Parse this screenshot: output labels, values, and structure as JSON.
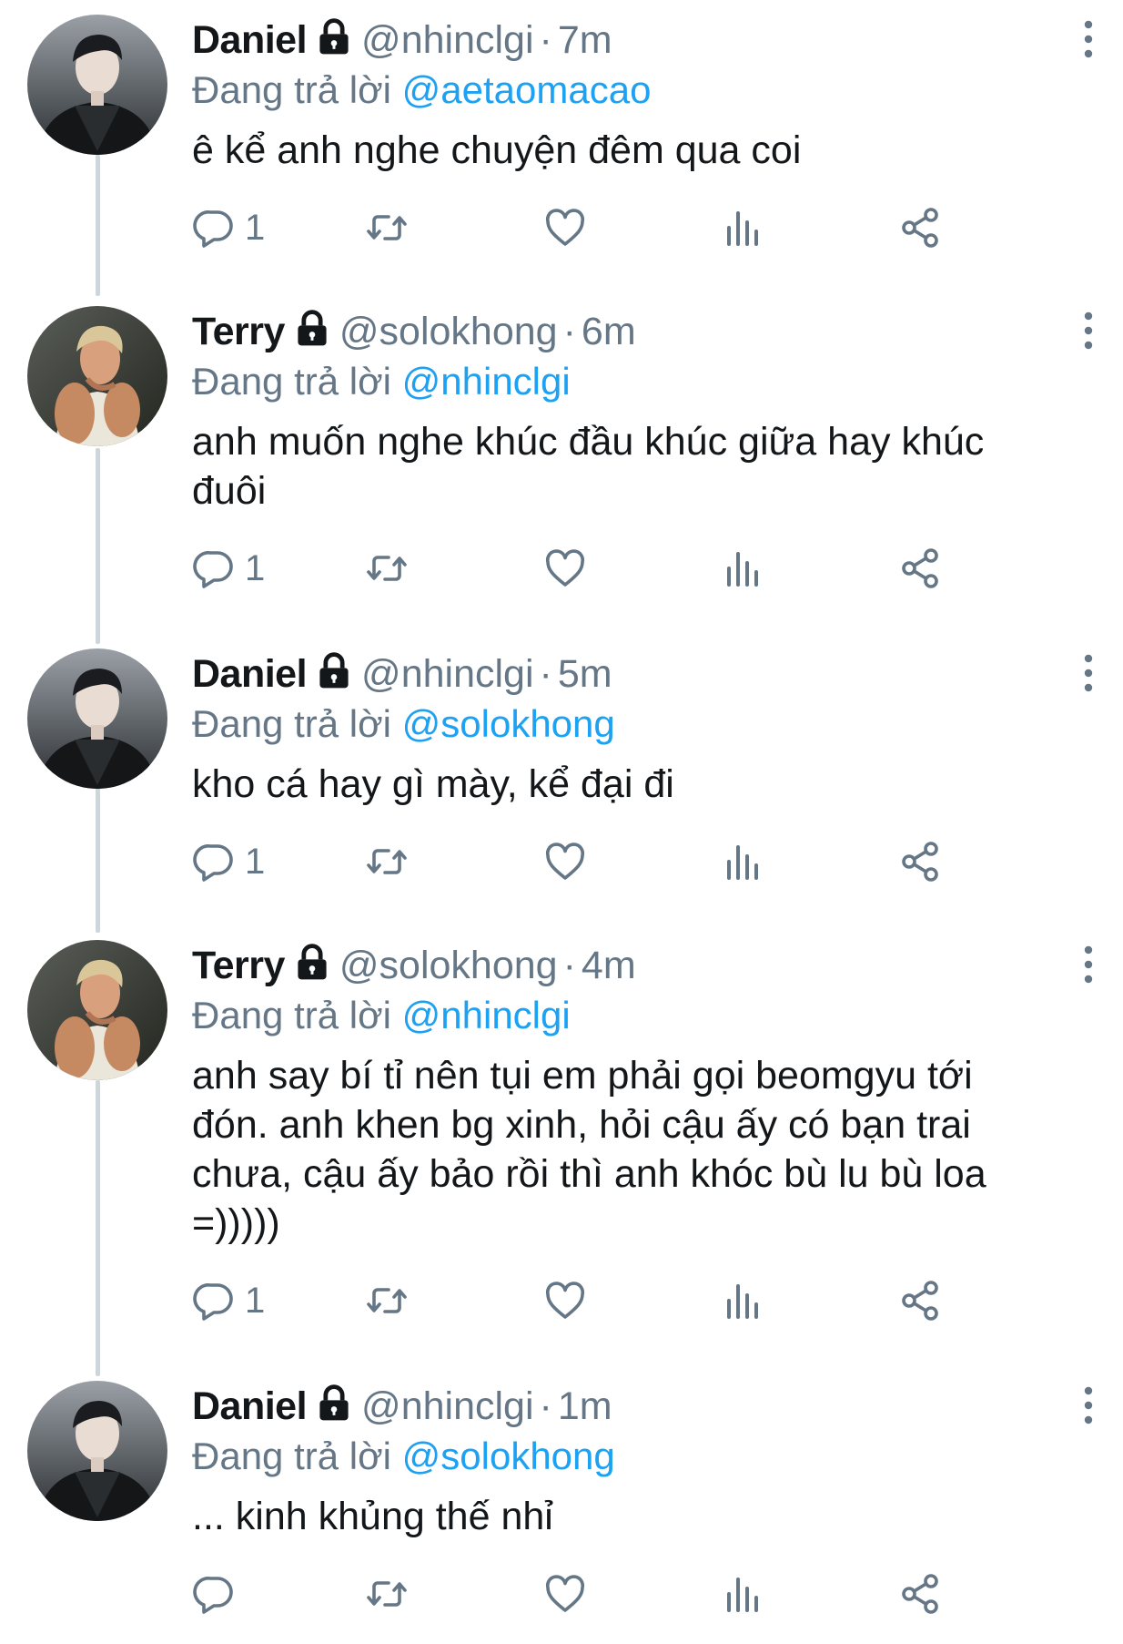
{
  "thread": {
    "tweets": [
      {
        "name": "Daniel",
        "handle": "@nhinclgi",
        "separator": "·",
        "time": "7m",
        "reply_prefix": "Đang trả lời",
        "reply_to": "@aetaomacao",
        "text": "ê kể anh nghe chuyện đêm qua coi",
        "reply_count": "1",
        "avatar": "daniel"
      },
      {
        "name": "Terry",
        "handle": "@solokhong",
        "separator": "·",
        "time": "6m",
        "reply_prefix": "Đang trả lời",
        "reply_to": "@nhinclgi",
        "text": "anh muốn nghe khúc đầu khúc giữa hay khúc đuôi",
        "reply_count": "1",
        "avatar": "terry"
      },
      {
        "name": "Daniel",
        "handle": "@nhinclgi",
        "separator": "·",
        "time": "5m",
        "reply_prefix": "Đang trả lời",
        "reply_to": "@solokhong",
        "text": "kho cá hay gì mày, kể đại đi",
        "reply_count": "1",
        "avatar": "daniel"
      },
      {
        "name": "Terry",
        "handle": "@solokhong",
        "separator": "·",
        "time": "4m",
        "reply_prefix": "Đang trả lời",
        "reply_to": "@nhinclgi",
        "text": "anh say bí tỉ nên tụi em phải gọi beomgyu tới đón. anh khen bg xinh, hỏi cậu ấy có bạn trai chưa, cậu ấy bảo rồi thì anh khóc bù lu bù loa =)))))",
        "reply_count": "1",
        "avatar": "terry"
      },
      {
        "name": "Daniel",
        "handle": "@nhinclgi",
        "separator": "·",
        "time": "1m",
        "reply_prefix": "Đang trả lời",
        "reply_to": "@solokhong",
        "text": "... kinh khủng thế nhỉ",
        "reply_count": "",
        "avatar": "daniel"
      }
    ]
  },
  "icons": {
    "protected": "lock-icon",
    "more": "more-vertical-icon",
    "reply": "reply-icon",
    "retweet": "retweet-icon",
    "like": "heart-icon",
    "analytics": "analytics-icon",
    "share": "share-icon"
  },
  "colors": {
    "text": "#14171a",
    "secondary": "#657786",
    "mention": "#1da1f2",
    "thread_line": "#ccd6dd",
    "background": "#ffffff"
  }
}
